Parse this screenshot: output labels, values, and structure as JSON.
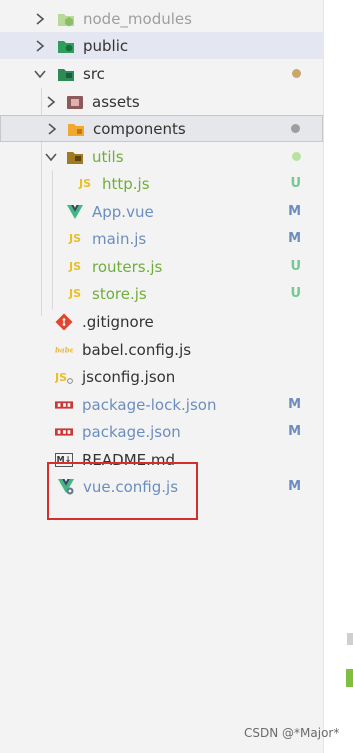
{
  "tree": {
    "items": [
      {
        "label": "node_modules",
        "status": "",
        "icon": "folder-node-icon"
      },
      {
        "label": "public",
        "status": "",
        "icon": "folder-public-icon"
      },
      {
        "label": "src",
        "status": "",
        "icon": "folder-src-icon"
      },
      {
        "label": "assets",
        "status": "",
        "icon": "folder-assets-icon"
      },
      {
        "label": "components",
        "status": "",
        "icon": "folder-components-icon"
      },
      {
        "label": "utils",
        "status": "",
        "icon": "folder-utils-icon"
      },
      {
        "label": "http.js",
        "status": "U",
        "icon": "js-file-icon"
      },
      {
        "label": "App.vue",
        "status": "M",
        "icon": "vue-file-icon"
      },
      {
        "label": "main.js",
        "status": "M",
        "icon": "js-file-icon"
      },
      {
        "label": "routers.js",
        "status": "U",
        "icon": "js-file-icon"
      },
      {
        "label": "store.js",
        "status": "U",
        "icon": "js-file-icon"
      },
      {
        "label": ".gitignore",
        "status": "",
        "icon": "git-file-icon"
      },
      {
        "label": "babel.config.js",
        "status": "",
        "icon": "babel-file-icon"
      },
      {
        "label": "jsconfig.json",
        "status": "",
        "icon": "json-file-icon"
      },
      {
        "label": "package-lock.json",
        "status": "M",
        "icon": "npm-file-icon"
      },
      {
        "label": "package.json",
        "status": "M",
        "icon": "npm-file-icon"
      },
      {
        "label": "README.md",
        "status": "",
        "icon": "markdown-file-icon"
      },
      {
        "label": "vue.config.js",
        "status": "M",
        "icon": "vue-config-file-icon"
      }
    ]
  },
  "colors": {
    "modified": "#6c8ebf",
    "untracked": "#73c991",
    "ignored": "#9e9e9e",
    "highlight": "#d32f2f"
  },
  "icons": {
    "js": "JS",
    "markdown": "M↓"
  },
  "watermark": "CSDN @*Major*"
}
